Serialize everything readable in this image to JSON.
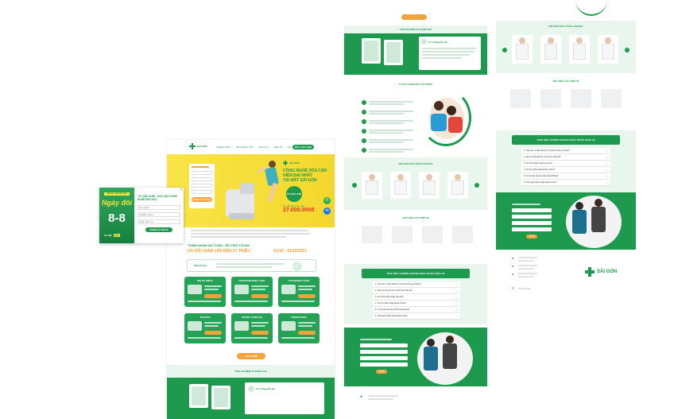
{
  "colors": {
    "brand_green": "#1e9a4e",
    "accent_orange": "#f2a33a",
    "hero_yellow": "#f6df3b",
    "light_green": "#e9f6ee"
  },
  "brand": {
    "name": "SÀI GÒN",
    "logo_icon": "green-cross-icon"
  },
  "nav": [
    "TRANG CHỦ",
    "VỀ CHÚNG TÔI",
    "DỊCH VỤ",
    "BÁC SĨ",
    "TIN TỨC",
    "LIÊN HỆ"
  ],
  "nav_cta": "ĐẶT LỊCH HẸN",
  "hero": {
    "headline": [
      "CÔNG NGHỆ XÓA CẬN",
      "HIỆN ĐẠI NHẤT",
      "TẠI MẮT SÀI GÒN"
    ],
    "badge": "ƯU ĐÃI LỚN",
    "price_caption": "Ưu đãi giảm lên đến",
    "price": "27.000.000đ",
    "form_button": "ĐĂNG KÝ NGAY"
  },
  "popup": {
    "tag": "Khuyến mãi đặc biệt",
    "title": "Ngày đôi",
    "big": "8-8",
    "subtitle": "Ưu đãi",
    "discount": "50%",
    "heading": "TƯ VẤN CARE - XÓA CẬN CÔNG NGHỆ MỚI 2022",
    "field_placeholders": [
      "Họ và tên",
      "Số điện thoại",
      "Chọn dịch vụ"
    ],
    "button": "ĐĂNG KÝ NGAY"
  },
  "promo": {
    "title": "THĂM KHÁM AN TOÀN - HỖ TRỢ TỐI ĐA",
    "subtitle": "ƯU ĐÃI GIẢM LÊN ĐẾN 27 TRIỆU",
    "dates": "01/10 - 31/10/2021",
    "phaco_label": "PHACO ICL",
    "services": [
      "RELEX SMILE",
      "FEMTOSECOND LASIK",
      "STANDARD LASIK",
      "ASA/PRK",
      "SMART SURFACE",
      "PRESBYOND"
    ],
    "more_button": "XEM THÊM"
  },
  "sections": {
    "experience": "TRẢI NGHIỆM VÀ ĐÁNH GIÁ",
    "why": "VÌ SAO CHỌN MẮT SÀI GÒN?",
    "doctors": "ĐỘI NGŨ BÁC SĨ ĐẦU NGÀNH",
    "equipment": "MÁY MÓC VÀ THIẾT BỊ",
    "faq": "THẮC MẮC THƯỜNG GẶP KHI PHẪU THUẬT KHÚC XẠ"
  },
  "reviewer": {
    "name": "Cô Ư Nguyễn Hà"
  },
  "faq_items": [
    "1. Xóa cận có đau không? Có ảnh hưởng gì không?",
    "2. Sau mổ bao lâu thì có thể sinh hoạt lại?",
    "3. Ai có thể phẫu thuật xóa cận?",
    "4. Chi phí phẫu thuật là bao nhiêu?",
    "5. Có tái cận lại sau phẫu thuật không?",
    "6. Thời gian phẫu thuật mất bao lâu?"
  ],
  "form_button": "GỬI",
  "footer": {
    "address_icon": "location-pin-icon",
    "phone_icon": "phone-icon"
  }
}
